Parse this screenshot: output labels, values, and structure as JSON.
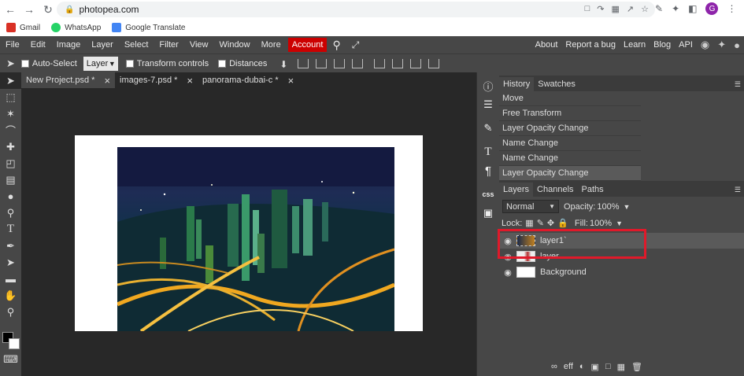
{
  "browser": {
    "url": "photopea.com",
    "avatar_letter": "G",
    "bookmarks": [
      {
        "label": "Gmail",
        "color": "#d93025"
      },
      {
        "label": "WhatsApp",
        "color": "#25d366"
      },
      {
        "label": "Google Translate",
        "color": "#4285f4"
      }
    ]
  },
  "menu": {
    "items": [
      "File",
      "Edit",
      "Image",
      "Layer",
      "Select",
      "Filter",
      "View",
      "Window",
      "More"
    ],
    "account": "Account",
    "right": [
      "About",
      "Report a bug",
      "Learn",
      "Blog",
      "API"
    ]
  },
  "options": {
    "auto_select": "Auto-Select",
    "layer_select": "Layer",
    "transform_controls": "Transform controls",
    "distances": "Distances"
  },
  "tabs": [
    {
      "label": "New Project.psd *",
      "active": false
    },
    {
      "label": "images-7.psd *",
      "active": false
    },
    {
      "label": "panorama-dubai-c *",
      "active": false
    }
  ],
  "history": {
    "tabs": [
      "History",
      "Swatches"
    ],
    "items": [
      "Move",
      "Free Transform",
      "Layer Opacity Change",
      "Name Change",
      "Name Change",
      "Layer Opacity Change"
    ]
  },
  "layers": {
    "tabs": [
      "Layers",
      "Channels",
      "Paths"
    ],
    "blend_mode": "Normal",
    "opacity_label": "Opacity:",
    "opacity_value": "100%",
    "lock_label": "Lock:",
    "fill_label": "Fill:",
    "fill_value": "100%",
    "items": [
      {
        "name": "layer1`"
      },
      {
        "name": "layer"
      },
      {
        "name": "Background"
      }
    ]
  },
  "colors": {
    "accent_red": "#e0192a",
    "account_bg": "#cc0000",
    "foreground": "#000000",
    "background": "#ffffff"
  }
}
